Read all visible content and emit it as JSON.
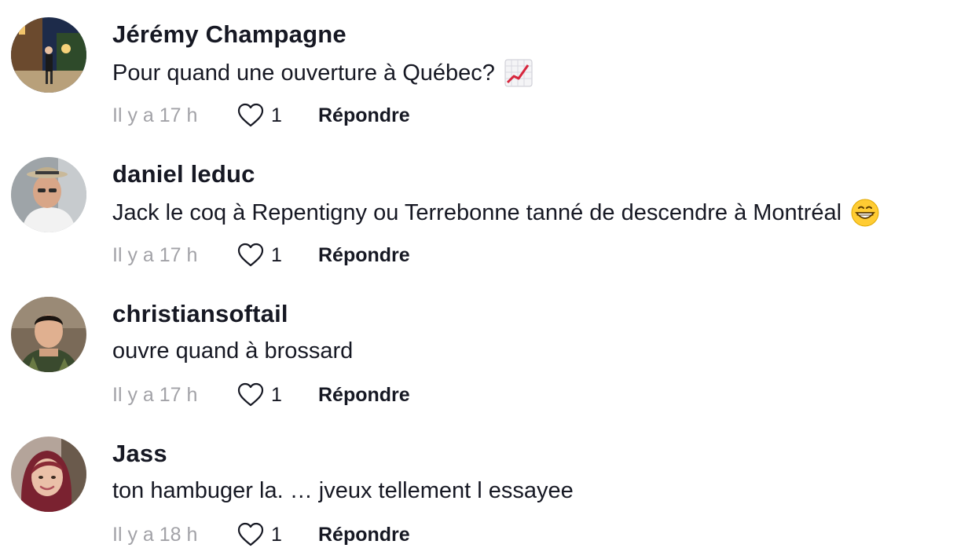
{
  "comments": [
    {
      "username": "Jérémy Champagne",
      "text": "Pour quand une ouverture à Québec?",
      "emoji": "chart-increasing",
      "time": "Il y a 17 h",
      "likes": "1",
      "reply": "Répondre"
    },
    {
      "username": "daniel leduc",
      "text": "Jack le coq à Repentigny ou Terrebonne tanné de descendre à Montréal",
      "emoji": "grinning-face",
      "time": "Il y a 17 h",
      "likes": "1",
      "reply": "Répondre"
    },
    {
      "username": "christiansoftail",
      "text": "ouvre quand à brossard",
      "emoji": "",
      "time": "Il y a 17 h",
      "likes": "1",
      "reply": "Répondre"
    },
    {
      "username": "Jass",
      "text": "ton hambuger la. … jveux tellement l essayee",
      "emoji": "",
      "time": "Il y a 18 h",
      "likes": "1",
      "reply": "Répondre"
    }
  ],
  "colors": {
    "primary_text": "#161823",
    "secondary_text": "#a2a2a7",
    "heart_outline": "#161823",
    "background": "#ffffff"
  }
}
